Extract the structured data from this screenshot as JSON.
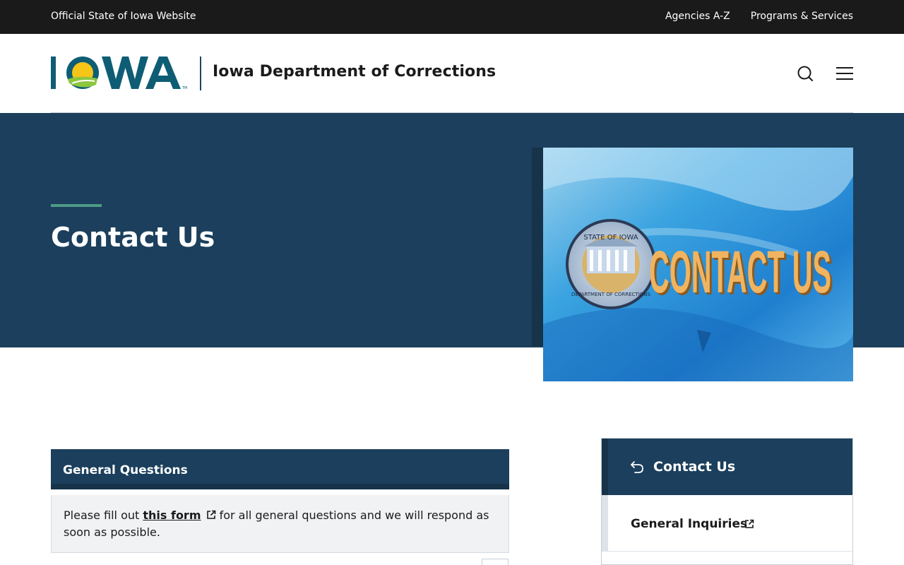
{
  "topbar": {
    "official": "Official State of Iowa Website",
    "links": [
      "Agencies A-Z",
      "Programs & Services"
    ]
  },
  "header": {
    "logo_text": "IOWA",
    "agency_name": "Iowa Department of Corrections",
    "icons": {
      "search": "search-icon",
      "menu": "hamburger-menu-icon"
    }
  },
  "hero": {
    "title": "Contact Us",
    "image_seal_top": "STATE OF IOWA",
    "image_seal_bottom": "DEPARTMENT OF CORRECTIONS",
    "image_caption": "CONTACT US"
  },
  "general_questions": {
    "title": "General Questions",
    "text_before": "Please fill out",
    "link": "this form",
    "text_after": "for all general questions and we will respond as soon as possible."
  },
  "sidebar": {
    "title": "Contact Us",
    "items": [
      {
        "label": "General Inquiries"
      }
    ]
  },
  "colors": {
    "topbar": "#1a1a1a",
    "navy": "#1b3f5c",
    "accent_green": "#4e9b86",
    "logo_teal": "#0e5d74",
    "logo_yellow": "#f5c518"
  }
}
